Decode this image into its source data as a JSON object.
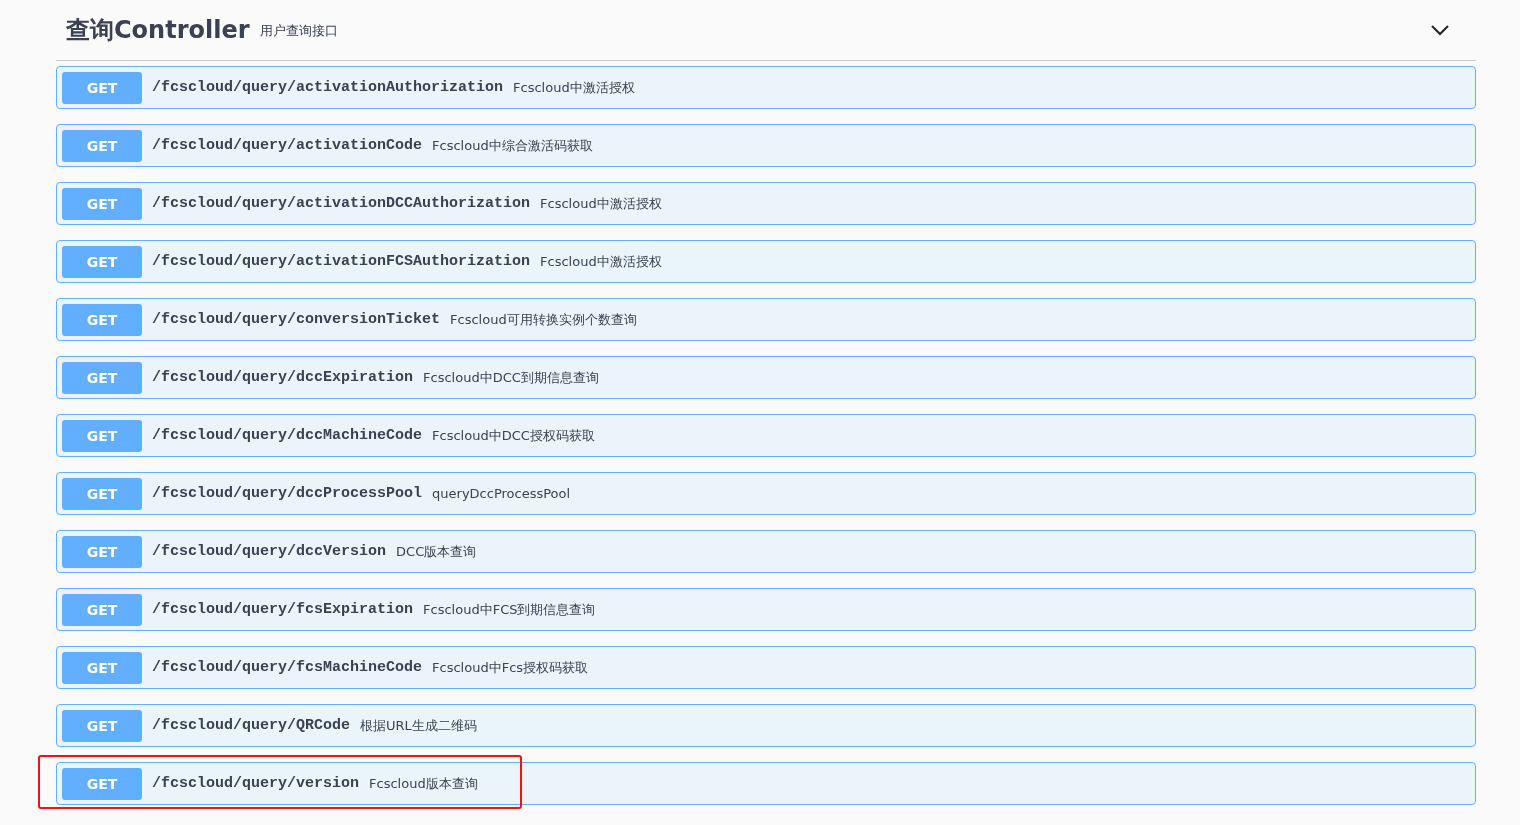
{
  "section": {
    "title": "查询Controller",
    "description": "用户查询接口",
    "expanded": true
  },
  "endpoints": [
    {
      "method": "GET",
      "path": "/fcscloud/query/activationAuthorization",
      "summary": "Fcscloud中激活授权",
      "highlighted": false
    },
    {
      "method": "GET",
      "path": "/fcscloud/query/activationCode",
      "summary": "Fcscloud中综合激活码获取",
      "highlighted": false
    },
    {
      "method": "GET",
      "path": "/fcscloud/query/activationDCCAuthorization",
      "summary": "Fcscloud中激活授权",
      "highlighted": false
    },
    {
      "method": "GET",
      "path": "/fcscloud/query/activationFCSAuthorization",
      "summary": "Fcscloud中激活授权",
      "highlighted": false
    },
    {
      "method": "GET",
      "path": "/fcscloud/query/conversionTicket",
      "summary": "Fcscloud可用转换实例个数查询",
      "highlighted": false
    },
    {
      "method": "GET",
      "path": "/fcscloud/query/dccExpiration",
      "summary": "Fcscloud中DCC到期信息查询",
      "highlighted": false
    },
    {
      "method": "GET",
      "path": "/fcscloud/query/dccMachineCode",
      "summary": "Fcscloud中DCC授权码获取",
      "highlighted": false
    },
    {
      "method": "GET",
      "path": "/fcscloud/query/dccProcessPool",
      "summary": "queryDccProcessPool",
      "highlighted": false
    },
    {
      "method": "GET",
      "path": "/fcscloud/query/dccVersion",
      "summary": "DCC版本查询",
      "highlighted": false
    },
    {
      "method": "GET",
      "path": "/fcscloud/query/fcsExpiration",
      "summary": "Fcscloud中FCS到期信息查询",
      "highlighted": false
    },
    {
      "method": "GET",
      "path": "/fcscloud/query/fcsMachineCode",
      "summary": "Fcscloud中Fcs授权码获取",
      "highlighted": false
    },
    {
      "method": "GET",
      "path": "/fcscloud/query/QRCode",
      "summary": "根据URL生成二维码",
      "highlighted": false
    },
    {
      "method": "GET",
      "path": "/fcscloud/query/version",
      "summary": "Fcscloud版本查询",
      "highlighted": true
    }
  ]
}
